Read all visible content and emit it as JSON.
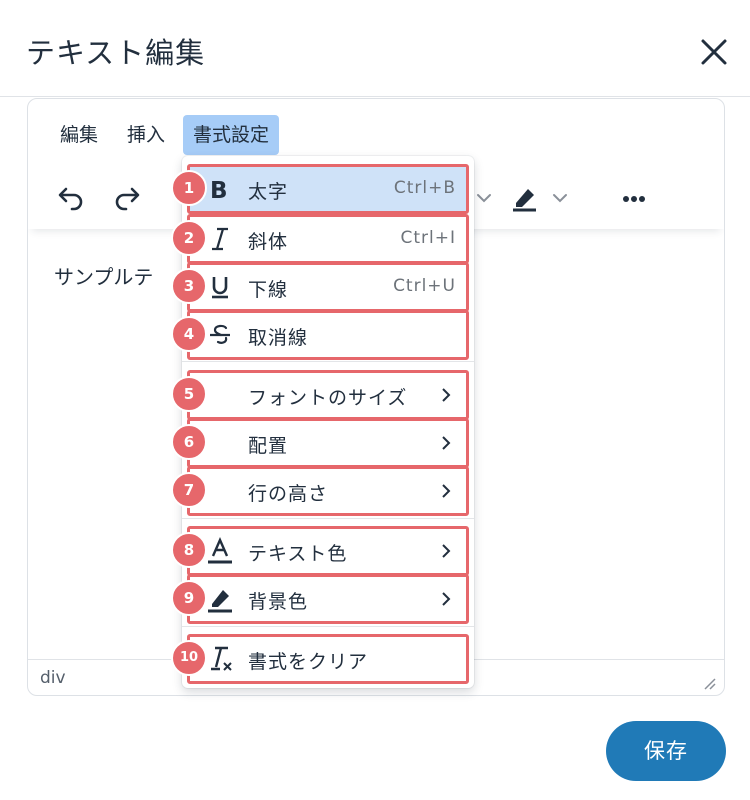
{
  "dialog": {
    "title": "テキスト編集",
    "close_icon": "close-icon"
  },
  "menubar": {
    "items": [
      "編集",
      "挿入",
      "書式設定"
    ],
    "active": "書式設定"
  },
  "toolbar": {
    "icons": [
      "undo-icon",
      "redo-icon",
      "chevron-down-icon",
      "highlighter-icon",
      "chevron-down-icon",
      "more-icon"
    ]
  },
  "content": {
    "text": "サンプルテ"
  },
  "statusbar": {
    "path": "div"
  },
  "format_menu": {
    "items": [
      {
        "number": "1",
        "icon": "bold-icon",
        "label": "太字",
        "shortcut": "Ctrl+B",
        "highlighted": true
      },
      {
        "number": "2",
        "icon": "italic-icon",
        "label": "斜体",
        "shortcut": "Ctrl+I"
      },
      {
        "number": "3",
        "icon": "underline-icon",
        "label": "下線",
        "shortcut": "Ctrl+U"
      },
      {
        "number": "4",
        "icon": "strikethrough-icon",
        "label": "取消線"
      },
      {
        "number": "5",
        "label": "フォントのサイズ",
        "submenu": true
      },
      {
        "number": "6",
        "label": "配置",
        "submenu": true
      },
      {
        "number": "7",
        "label": "行の高さ",
        "submenu": true
      },
      {
        "number": "8",
        "icon": "text-color-icon",
        "label": "テキスト色",
        "submenu": true
      },
      {
        "number": "9",
        "icon": "background-color-icon",
        "label": "背景色",
        "submenu": true
      },
      {
        "number": "10",
        "icon": "clear-formatting-icon",
        "label": "書式をクリア"
      }
    ]
  },
  "footer": {
    "save_label": "保存"
  },
  "colors": {
    "accent": "#207ab7",
    "annotation": "#e6676b",
    "menu_active": "#a6ccf7",
    "item_highlight": "#cfe2f8"
  }
}
